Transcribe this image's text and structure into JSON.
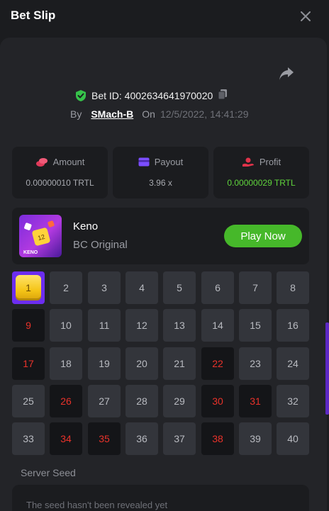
{
  "header": {
    "title": "Bet Slip"
  },
  "bet": {
    "id_text": "Bet ID: 4002634641970020",
    "by_label": "By",
    "user": "SMach-B",
    "on_label": "On",
    "datetime": "12/5/2022, 14:41:29"
  },
  "stats": {
    "amount": {
      "label": "Amount",
      "value": "0.00000010 TRTL",
      "icon": "coins-icon"
    },
    "payout": {
      "label": "Payout",
      "value": "3.96 x",
      "icon": "card-icon"
    },
    "profit": {
      "label": "Profit",
      "value": "0.00000029 TRTL",
      "icon": "hand-coin-icon"
    }
  },
  "game": {
    "name": "Keno",
    "subtitle": "BC Original",
    "play_label": "Play Now",
    "thumb_text": "KENO",
    "thumb_number": "12"
  },
  "keno": {
    "numbers": [
      "1",
      "2",
      "3",
      "4",
      "5",
      "6",
      "7",
      "8",
      "9",
      "10",
      "11",
      "12",
      "13",
      "14",
      "15",
      "16",
      "17",
      "18",
      "19",
      "20",
      "21",
      "22",
      "23",
      "24",
      "25",
      "26",
      "27",
      "28",
      "29",
      "30",
      "31",
      "32",
      "33",
      "34",
      "35",
      "36",
      "37",
      "38",
      "39",
      "40"
    ],
    "hits": [
      9,
      17,
      22,
      26,
      30,
      31,
      34,
      35,
      38
    ],
    "selected": [
      1
    ]
  },
  "seed": {
    "label": "Server Seed",
    "text": "The seed hasn't been revealed yet"
  },
  "colors": {
    "accent_purple": "#6c2df0",
    "play_green": "#46b82a",
    "profit_green": "#5fd33c",
    "hit_red": "#e8322a",
    "shield_green": "#36c24a"
  }
}
